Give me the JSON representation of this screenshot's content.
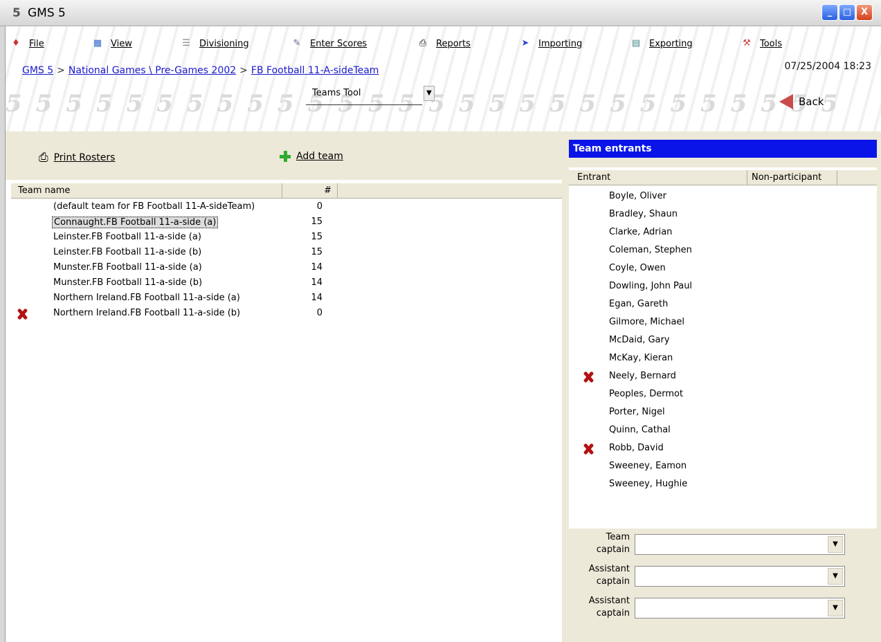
{
  "window": {
    "logo": "5",
    "title": "GMS 5",
    "minimize": "_",
    "maximize": "□",
    "close": "X"
  },
  "menu": [
    {
      "label": "File",
      "icon": "file-icon"
    },
    {
      "label": "View",
      "icon": "view-icon"
    },
    {
      "label": "Divisioning",
      "icon": "divisioning-icon"
    },
    {
      "label": "Enter Scores",
      "icon": "enter-scores-icon"
    },
    {
      "label": "Reports",
      "icon": "printer-icon"
    },
    {
      "label": "Importing",
      "icon": "importing-icon"
    },
    {
      "label": "Exporting",
      "icon": "exporting-icon"
    },
    {
      "label": "Tools",
      "icon": "tools-icon"
    }
  ],
  "breadcrumb": {
    "items": [
      "GMS 5",
      "National Games \\ Pre-Games 2002",
      "FB Football 11-A-sideTeam"
    ],
    "separator": ">"
  },
  "datetime": "07/25/2004 18:23",
  "tool_select": {
    "value": "Teams Tool"
  },
  "back_label": "Back",
  "background_mark": "5",
  "toolbar": {
    "print_rosters": "Print Rosters",
    "add_team": "Add team"
  },
  "teams": {
    "columns": [
      "Team name",
      "#"
    ],
    "rows": [
      {
        "name": "(default team for FB Football 11-A-sideTeam)",
        "count": "0",
        "flag": false,
        "selected": false
      },
      {
        "name": "Connaught.FB Football 11-a-side (a)",
        "count": "15",
        "flag": false,
        "selected": true
      },
      {
        "name": "Leinster.FB Football 11-a-side (a)",
        "count": "15",
        "flag": false,
        "selected": false
      },
      {
        "name": "Leinster.FB Football 11-a-side (b)",
        "count": "15",
        "flag": false,
        "selected": false
      },
      {
        "name": "Munster.FB Football 11-a-side (a)",
        "count": "14",
        "flag": false,
        "selected": false
      },
      {
        "name": "Munster.FB Football 11-a-side (b)",
        "count": "14",
        "flag": false,
        "selected": false
      },
      {
        "name": "Northern Ireland.FB Football 11-a-side (a)",
        "count": "14",
        "flag": false,
        "selected": false
      },
      {
        "name": "Northern Ireland.FB Football 11-a-side (b)",
        "count": "0",
        "flag": true,
        "selected": false
      }
    ]
  },
  "entrants": {
    "title": "Team entrants",
    "columns": [
      "Entrant",
      "Non-participant"
    ],
    "rows": [
      {
        "name": "Boyle, Oliver",
        "flag": false
      },
      {
        "name": "Bradley, Shaun",
        "flag": false
      },
      {
        "name": "Clarke, Adrian",
        "flag": false
      },
      {
        "name": "Coleman, Stephen",
        "flag": false
      },
      {
        "name": "Coyle, Owen",
        "flag": false
      },
      {
        "name": "Dowling, John Paul",
        "flag": false
      },
      {
        "name": "Egan, Gareth",
        "flag": false
      },
      {
        "name": "Gilmore, Michael",
        "flag": false
      },
      {
        "name": "McDaid, Gary",
        "flag": false
      },
      {
        "name": "McKay, Kieran",
        "flag": false
      },
      {
        "name": "Neely, Bernard",
        "flag": true
      },
      {
        "name": "Peoples, Dermot",
        "flag": false
      },
      {
        "name": "Porter, Nigel",
        "flag": false
      },
      {
        "name": "Quinn, Cathal",
        "flag": false
      },
      {
        "name": "Robb, David",
        "flag": true
      },
      {
        "name": "Sweeney, Eamon",
        "flag": false
      },
      {
        "name": "Sweeney, Hughie",
        "flag": false
      }
    ]
  },
  "captains": [
    {
      "label_line1": "Team",
      "label_line2": "captain",
      "value": ""
    },
    {
      "label_line1": "Assistant",
      "label_line2": "captain",
      "value": ""
    },
    {
      "label_line1": "Assistant",
      "label_line2": "captain",
      "value": ""
    }
  ],
  "colors": {
    "panel_title_bg": "#0a14e8",
    "link": "#1a1acc",
    "flag_red": "#b21212",
    "add_green": "#2eab2e"
  }
}
